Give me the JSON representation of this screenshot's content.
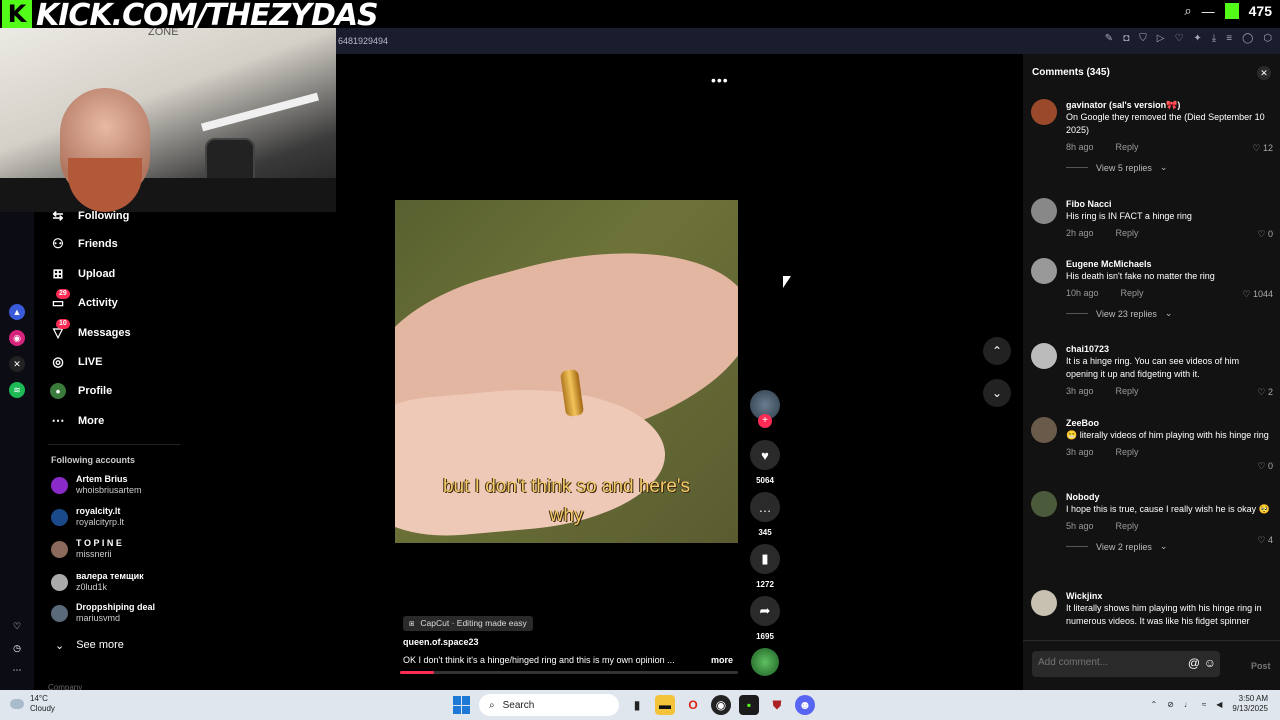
{
  "overlay": {
    "kick_logo": "K",
    "kick_url": "KICK.COM/THEZYDAS",
    "viewer_count": "475"
  },
  "browser": {
    "url": "6481929494"
  },
  "webcam": {
    "shirt_text": "ZONE"
  },
  "sidebar": {
    "items": [
      {
        "label": "Following",
        "icon": "following-icon"
      },
      {
        "label": "Friends",
        "icon": "friends-icon"
      },
      {
        "label": "Upload",
        "icon": "upload-icon"
      },
      {
        "label": "Activity",
        "icon": "activity-icon",
        "badge": "29"
      },
      {
        "label": "Messages",
        "icon": "messages-icon",
        "badge": "10"
      },
      {
        "label": "LIVE",
        "icon": "live-icon"
      },
      {
        "label": "Profile",
        "icon": "profile-icon"
      },
      {
        "label": "More",
        "icon": "more-icon"
      }
    ],
    "following_title": "Following accounts",
    "accounts": [
      {
        "name": "Artem Brius",
        "handle": "whoisbriusartem"
      },
      {
        "name": "royalcity.lt",
        "handle": "royalcityrp.lt"
      },
      {
        "name": "T O P I N E",
        "handle": "missnerii"
      },
      {
        "name": "валера темщик",
        "handle": "z0lud1k"
      },
      {
        "name": "Droppshiping deal",
        "handle": "mariusvmd"
      }
    ],
    "see_more": "See more",
    "company": "Company"
  },
  "video": {
    "caption_line1": "but I don't think so and here's",
    "caption_line2": "why",
    "capcut": "CapCut · Editing made easy",
    "author": "queen.of.space23",
    "description": "OK I don't think it's a hinge/hinged ring and this is my own opinion ...",
    "more": "more",
    "progress": 0.1,
    "likes": "5064",
    "comments": "345",
    "saves": "1272",
    "shares": "1695"
  },
  "comments_panel": {
    "title": "Comments (345)",
    "input_placeholder": "Add comment...",
    "post": "Post",
    "items": [
      {
        "name": "gavinator (sal's version🎀)",
        "text": "On Google they removed the (Died September 10 2025)",
        "time": "8h ago",
        "reply": "Reply",
        "likes": "12",
        "replies": "View 5 replies"
      },
      {
        "name": "Fibo Nacci",
        "text": "His ring is IN FACT a hinge ring",
        "time": "2h ago",
        "reply": "Reply",
        "likes": "0"
      },
      {
        "name": "Eugene McMichaels",
        "text": "His death isn't fake no matter the ring",
        "time": "10h ago",
        "reply": "Reply",
        "likes": "1044",
        "replies": "View 23 replies"
      },
      {
        "name": "chai10723",
        "text": "It is a hinge ring. You can see videos of him opening it up and fidgeting with it.",
        "time": "3h ago",
        "reply": "Reply",
        "likes": "2"
      },
      {
        "name": "ZeeBoo",
        "text": "😬 literally videos of him playing with his hinge ring",
        "time": "3h ago",
        "reply": "Reply",
        "likes": "0"
      },
      {
        "name": "Nobody",
        "text": "I hope this is true, cause I really wish he is okay 🥺",
        "time": "5h ago",
        "reply": "Reply",
        "likes": "4",
        "replies": "View 2 replies"
      },
      {
        "name": "Wickjinx",
        "text": "It literally shows him playing with his hinge ring in numerous videos. It was like his fidget spinner",
        "time": "",
        "reply": "",
        "likes": ""
      }
    ]
  },
  "taskbar": {
    "temp": "14°C",
    "weather": "Cloudy",
    "search": "Search",
    "time": "3:50 AM",
    "date": "9/13/2025"
  },
  "colors": {
    "accent": "#fe2c55",
    "kick_green": "#53fc18"
  }
}
